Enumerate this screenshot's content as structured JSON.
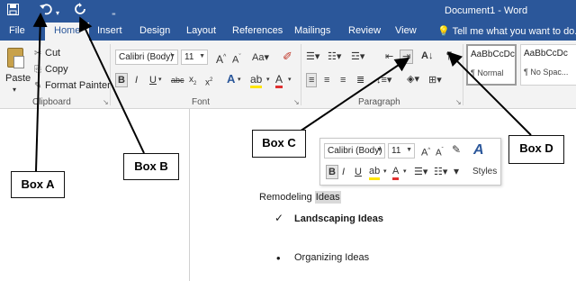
{
  "title_bar": {
    "document_title": "Document1 - Word",
    "save_icon": "save-icon",
    "undo_icon": "undo-icon",
    "redo_icon": "redo-icon"
  },
  "tabs": {
    "file": "File",
    "home": "Home",
    "insert": "Insert",
    "design": "Design",
    "layout": "Layout",
    "references": "References",
    "mailings": "Mailings",
    "review": "Review",
    "view": "View",
    "tell_me": "Tell me what you want to do..."
  },
  "clipboard": {
    "paste": "Paste",
    "cut": "Cut",
    "copy": "Copy",
    "format_painter": "Format Painter",
    "label": "Clipboard"
  },
  "font": {
    "font_name": "Calibri (Body)",
    "font_size": "11",
    "label": "Font"
  },
  "paragraph": {
    "label": "Paragraph"
  },
  "styles": {
    "normal_sample": "AaBbCcDc",
    "normal_name": "¶ Normal",
    "nospacing_sample": "AaBbCcDc",
    "nospacing_name": "¶ No Spac..."
  },
  "mini_toolbar": {
    "font_name": "Calibri (Body)",
    "font_size": "11",
    "styles_label": "Styles"
  },
  "document": {
    "line1_prefix": "Remodeling ",
    "line1_selected": "Ideas",
    "item1_marker": "✓",
    "item1": "Landscaping Ideas",
    "item2_marker": "•",
    "item2": "Organizing Ideas"
  },
  "callouts": {
    "box_a": "Box A",
    "box_b": "Box B",
    "box_c": "Box C",
    "box_d": "Box D"
  },
  "colors": {
    "ribbon_blue": "#2b579a",
    "ribbon_bg": "#f3f3f3"
  }
}
